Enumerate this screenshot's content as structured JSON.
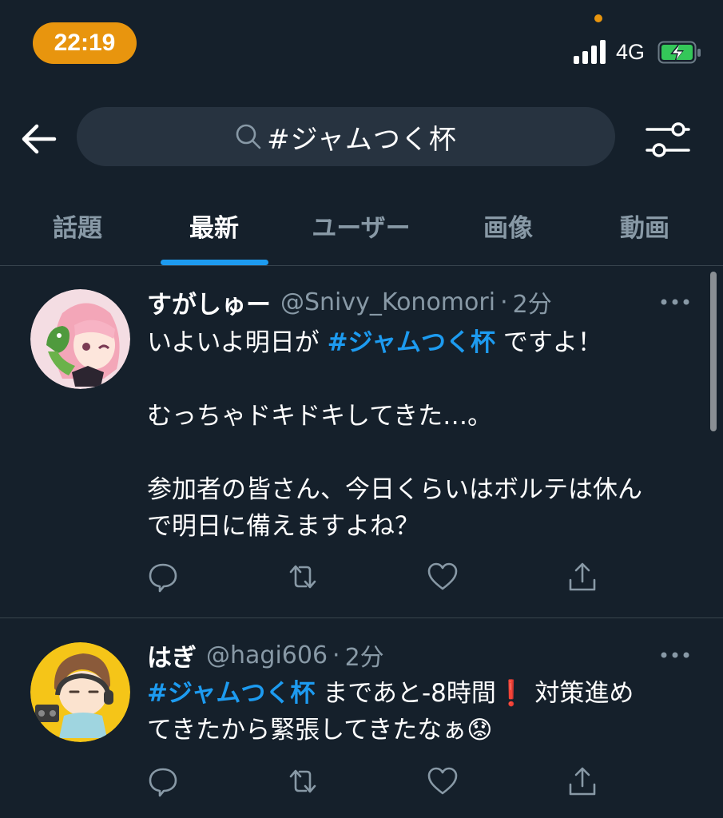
{
  "status_bar": {
    "time": "22:19",
    "network": "4G"
  },
  "search": {
    "query": "#ジャムつく杯"
  },
  "tabs": [
    {
      "label": "話題"
    },
    {
      "label": "最新"
    },
    {
      "label": "ユーザー"
    },
    {
      "label": "画像"
    },
    {
      "label": "動画"
    }
  ],
  "active_tab": "最新",
  "tweets": [
    {
      "display_name": "すがしゅー",
      "handle": "@Snivy_Konomori",
      "separator": "·",
      "time": "2分",
      "lines": {
        "l1_prefix": "いよいよ明日が ",
        "l1_hashtag": "#ジャムつく杯",
        "l1_suffix": " ですよ！",
        "l2": "むっちゃドキドキしてきた…。",
        "l3": "参加者の皆さん、今日くらいはボルテは休ん",
        "l4": "で明日に備えますよね？"
      }
    },
    {
      "display_name": "はぎ",
      "handle": "@hagi606",
      "separator": "·",
      "time": "2分",
      "lines": {
        "l1_hashtag": "#ジャムつく杯",
        "l1_suffix": " まであと-8時間",
        "l1_emoji": "❗",
        "l1_tail": " 対策進め",
        "l2": "てきたから緊張してきたなぁ",
        "l2_emoji": "😟"
      }
    }
  ],
  "colors": {
    "background": "#15202b",
    "accent": "#1d9bf0",
    "muted": "#8899a6",
    "time_pill": "#e8950e"
  }
}
